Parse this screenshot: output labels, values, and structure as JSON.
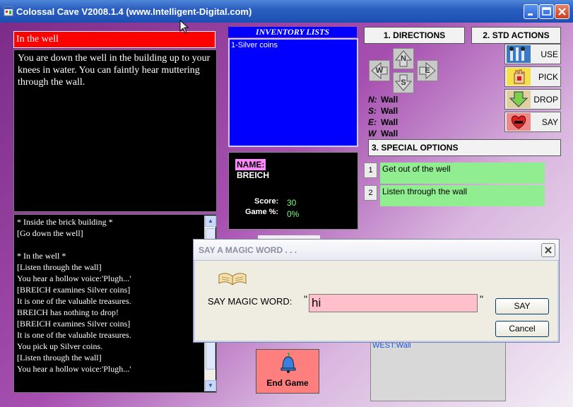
{
  "window": {
    "title": "Colossal Cave V2008.1.4 (www.Intelligent-Digital.com)"
  },
  "location": {
    "title": "In the well",
    "description": "You are down  the well in the building up to your knees in water. You can faintly hear muttering through the wall."
  },
  "log": [
    "* Inside the brick building *",
    "[Go down the well]",
    "",
    "* In the well *",
    "[Listen through the wall]",
    "You hear a hollow voice:'Plugh...'",
    "[BREICH examines Silver coins]",
    "It is one of the valuable treasures.",
    "BREICH has nothing to drop!",
    "[BREICH examines Silver coins]",
    "It is one of the valuable treasures.",
    "You pick up Silver coins.",
    "[Listen through the wall]",
    "You hear a hollow voice:'Plugh...'"
  ],
  "inventory": {
    "title": "INVENTORY LISTS",
    "items": [
      "1-Silver coins"
    ]
  },
  "stats": {
    "name_label": "NAME:",
    "name": "BREICH",
    "score_label": "Score:",
    "score": "30",
    "game_label": "Game %:",
    "game_pct": "0%"
  },
  "sections": {
    "directions": "1. DIRECTIONS",
    "std_actions": "2. STD ACTIONS",
    "special": "3. SPECIAL OPTIONS"
  },
  "dpad": {
    "n": "N",
    "s": "S",
    "e": "E",
    "w": "W"
  },
  "exits": [
    {
      "dir": "N:",
      "value": "Wall"
    },
    {
      "dir": "S:",
      "value": "Wall"
    },
    {
      "dir": "E:",
      "value": "Wall"
    },
    {
      "dir": "W",
      "value": "Wall"
    }
  ],
  "actions": [
    "USE",
    "PICK",
    "DROP",
    "SAY"
  ],
  "special_options": [
    {
      "num": "1",
      "text": "Get out of the well"
    },
    {
      "num": "2",
      "text": "Listen through the wall"
    }
  ],
  "end_game": "End Game",
  "west_info": "WEST:Wall",
  "dialog": {
    "title": "SAY  A MAGIC WORD . . .",
    "label": "SAY MAGIC WORD:",
    "open_quote": "\"",
    "close_quote": "\"",
    "value": "hi",
    "ok": "SAY",
    "cancel": "Cancel"
  },
  "colors": {
    "location_title_bg": "#ff0000",
    "inventory_bg": "#0000ff",
    "option_bg": "#90ee90",
    "end_game_bg": "#ff7f7f",
    "input_bg": "#ffc0cb"
  }
}
